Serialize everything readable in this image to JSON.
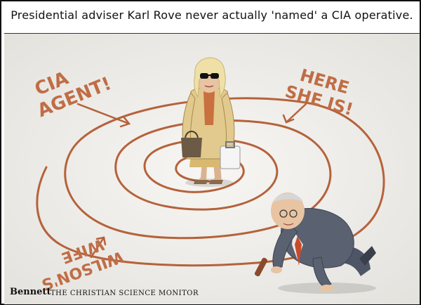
{
  "caption": "Presidential adviser Karl Rove never actually 'named' a CIA operative.",
  "chalk_labels": {
    "cia_agent_line1": "CIA",
    "cia_agent_line2": "AGENT!",
    "here_she_is_line1": "HERE",
    "here_she_is_line2": "SHE IS!",
    "wilsons_wife_line1": "WILSON'S",
    "wilsons_wife_line2": "WIFE"
  },
  "signature": "Bennett",
  "credit": "THE CHRISTIAN SCIENCE MONITOR",
  "colors": {
    "chalk": "#b5623b",
    "floor": "#f2f1ee",
    "coat": "#e2c98e",
    "suit": "#5a6170"
  }
}
